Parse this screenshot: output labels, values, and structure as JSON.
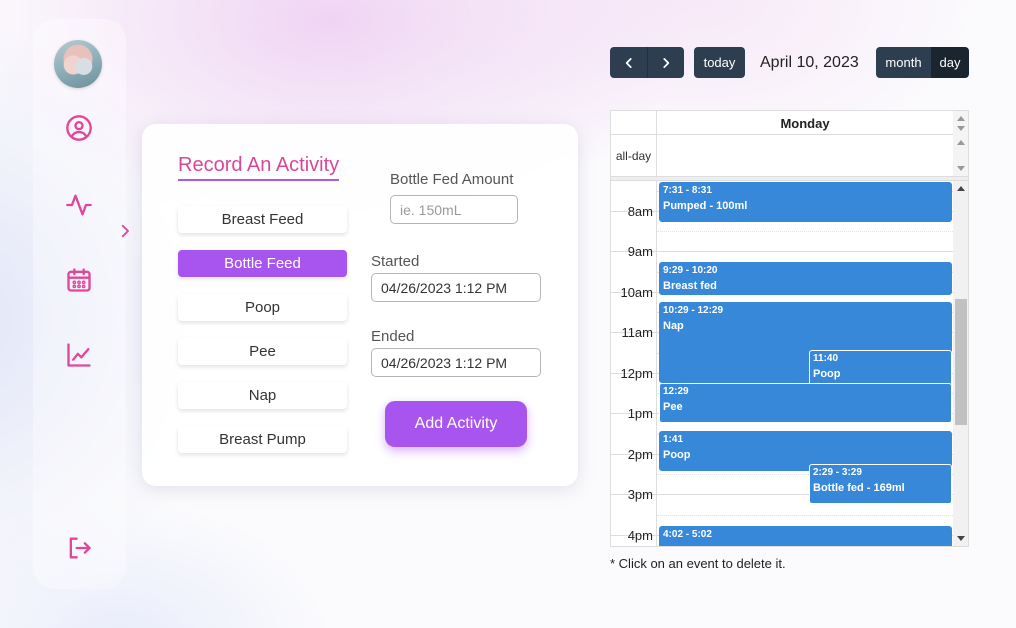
{
  "sidebar": {
    "icons": [
      "user-circle-icon",
      "activity-pulse-icon",
      "calendar-icon",
      "chart-line-icon",
      "logout-icon"
    ],
    "accent_color": "#e0479a"
  },
  "form": {
    "title": "Record An Activity",
    "activities": [
      {
        "label": "Breast Feed",
        "selected": false
      },
      {
        "label": "Bottle Feed",
        "selected": true
      },
      {
        "label": "Poop",
        "selected": false
      },
      {
        "label": "Pee",
        "selected": false
      },
      {
        "label": "Nap",
        "selected": false
      },
      {
        "label": "Breast Pump",
        "selected": false
      }
    ],
    "amount_label": "Bottle Fed Amount",
    "amount_placeholder": "ie. 150mL",
    "started_label": "Started",
    "started_value": "04/26/2023 1:12 PM",
    "ended_label": "Ended",
    "ended_value": "04/26/2023 1:12 PM",
    "submit_label": "Add Activity",
    "selected_color": "#a855f0"
  },
  "calendar": {
    "today_label": "today",
    "date_title": "April 10, 2023",
    "view_month_label": "month",
    "view_day_label": "day",
    "active_view": "day",
    "day_header": "Monday",
    "allday_label": "all-day",
    "time_labels": [
      "8am",
      "9am",
      "10am",
      "11am",
      "12pm",
      "1pm",
      "2pm",
      "3pm",
      "4pm"
    ],
    "event_color": "#3788d8",
    "events": [
      {
        "time": "7:31 - 8:31",
        "title": "Pumped - 100ml"
      },
      {
        "time": "9:29 - 10:20",
        "title": "Breast fed"
      },
      {
        "time": "10:29 - 12:29",
        "title": "Nap"
      },
      {
        "time": "11:40",
        "title": "Poop"
      },
      {
        "time": "12:29",
        "title": "Pee"
      },
      {
        "time": "1:41",
        "title": "Poop"
      },
      {
        "time": "2:29 - 3:29",
        "title": "Bottle fed - 169ml"
      },
      {
        "time": "4:02 - 5:02",
        "title": ""
      }
    ],
    "footnote": "* Click on an event to delete it."
  }
}
